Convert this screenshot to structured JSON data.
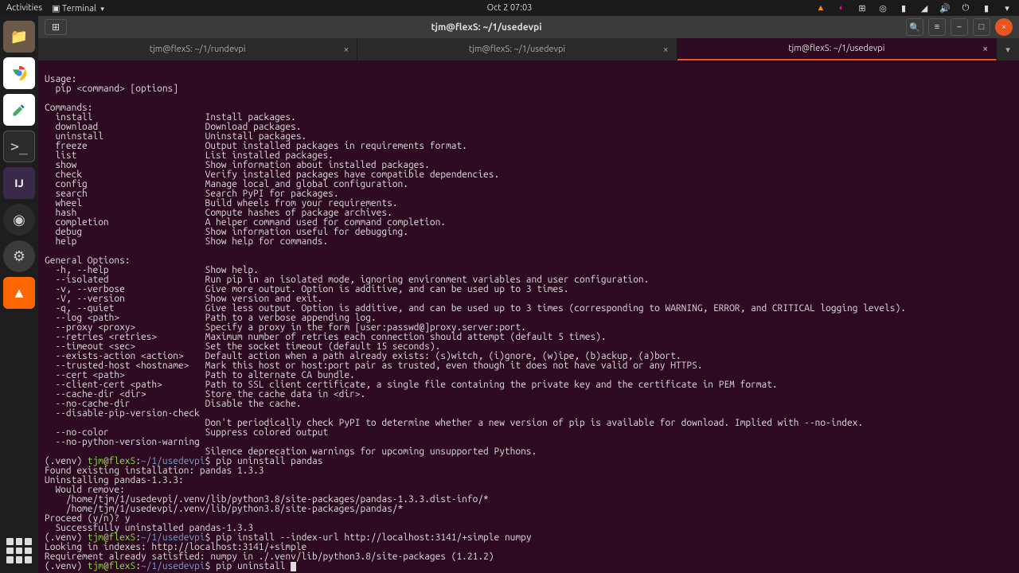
{
  "topbar": {
    "activities": "Activities",
    "appmenu": "Terminal",
    "clock": "Oct 2  07:03"
  },
  "dock": {
    "files": "📁",
    "chrome": "◐",
    "editor": "✎",
    "term": ">_",
    "ij": "IJ",
    "obs": "◉",
    "settings": "⚙",
    "vlc": "▲"
  },
  "window": {
    "title": "tjm@flexS: ~/1/usedevpi",
    "newtab_icon": "⊞",
    "search_icon": "🔍",
    "menu_icon": "≡",
    "min_icon": "–",
    "max_icon": "□",
    "close_icon": "×"
  },
  "tabs": [
    {
      "label": "tjm@flexS: ~/1/rundevpi",
      "active": false
    },
    {
      "label": "tjm@flexS: ~/1/usedevpi",
      "active": false
    },
    {
      "label": "tjm@flexS: ~/1/usedevpi",
      "active": true
    }
  ],
  "tab_close": "×",
  "tab_add": "▾",
  "help_block": [
    "",
    "Usage:",
    "  pip <command> [options]",
    "",
    "Commands:",
    "  install                     Install packages.",
    "  download                    Download packages.",
    "  uninstall                   Uninstall packages.",
    "  freeze                      Output installed packages in requirements format.",
    "  list                        List installed packages.",
    "  show                        Show information about installed packages.",
    "  check                       Verify installed packages have compatible dependencies.",
    "  config                      Manage local and global configuration.",
    "  search                      Search PyPI for packages.",
    "  wheel                       Build wheels from your requirements.",
    "  hash                        Compute hashes of package archives.",
    "  completion                  A helper command used for command completion.",
    "  debug                       Show information useful for debugging.",
    "  help                        Show help for commands.",
    "",
    "General Options:",
    "  -h, --help                  Show help.",
    "  --isolated                  Run pip in an isolated mode, ignoring environment variables and user configuration.",
    "  -v, --verbose               Give more output. Option is additive, and can be used up to 3 times.",
    "  -V, --version               Show version and exit.",
    "  -q, --quiet                 Give less output. Option is additive, and can be used up to 3 times (corresponding to WARNING, ERROR, and CRITICAL logging levels).",
    "  --log <path>                Path to a verbose appending log.",
    "  --proxy <proxy>             Specify a proxy in the form [user:passwd@]proxy.server:port.",
    "  --retries <retries>         Maximum number of retries each connection should attempt (default 5 times).",
    "  --timeout <sec>             Set the socket timeout (default 15 seconds).",
    "  --exists-action <action>    Default action when a path already exists: (s)witch, (i)gnore, (w)ipe, (b)ackup, (a)bort.",
    "  --trusted-host <hostname>   Mark this host or host:port pair as trusted, even though it does not have valid or any HTTPS.",
    "  --cert <path>               Path to alternate CA bundle.",
    "  --client-cert <path>        Path to SSL client certificate, a single file containing the private key and the certificate in PEM format.",
    "  --cache-dir <dir>           Store the cache data in <dir>.",
    "  --no-cache-dir              Disable the cache.",
    "  --disable-pip-version-check",
    "                              Don't periodically check PyPI to determine whether a new version of pip is available for download. Implied with --no-index.",
    "  --no-color                  Suppress colored output",
    "  --no-python-version-warning",
    "                              Silence deprecation warnings for upcoming unsupported Pythons."
  ],
  "session": [
    {
      "type": "prompt",
      "venv": "(.venv) ",
      "userhost": "tjm@flexS",
      "sep": ":",
      "path": "~/1/usedevpi",
      "dollar": "$ ",
      "cmd": "pip uninstall pandas"
    },
    {
      "type": "out",
      "text": "Found existing installation: pandas 1.3.3"
    },
    {
      "type": "out",
      "text": "Uninstalling pandas-1.3.3:"
    },
    {
      "type": "out",
      "text": "  Would remove:"
    },
    {
      "type": "out",
      "text": "    /home/tjm/1/usedevpi/.venv/lib/python3.8/site-packages/pandas-1.3.3.dist-info/*"
    },
    {
      "type": "out",
      "text": "    /home/tjm/1/usedevpi/.venv/lib/python3.8/site-packages/pandas/*"
    },
    {
      "type": "out",
      "text": "Proceed (y/n)? y"
    },
    {
      "type": "out",
      "text": "  Successfully uninstalled pandas-1.3.3"
    },
    {
      "type": "prompt",
      "venv": "(.venv) ",
      "userhost": "tjm@flexS",
      "sep": ":",
      "path": "~/1/usedevpi",
      "dollar": "$ ",
      "cmd": "pip install --index-url http://localhost:3141/+simple numpy"
    },
    {
      "type": "out",
      "text": "Looking in indexes: http://localhost:3141/+simple"
    },
    {
      "type": "out",
      "text": "Requirement already satisfied: numpy in ./.venv/lib/python3.8/site-packages (1.21.2)"
    },
    {
      "type": "prompt",
      "venv": "(.venv) ",
      "userhost": "tjm@flexS",
      "sep": ":",
      "path": "~/1/usedevpi",
      "dollar": "$ ",
      "cmd": "pip uninstall ",
      "cursor": true
    }
  ]
}
